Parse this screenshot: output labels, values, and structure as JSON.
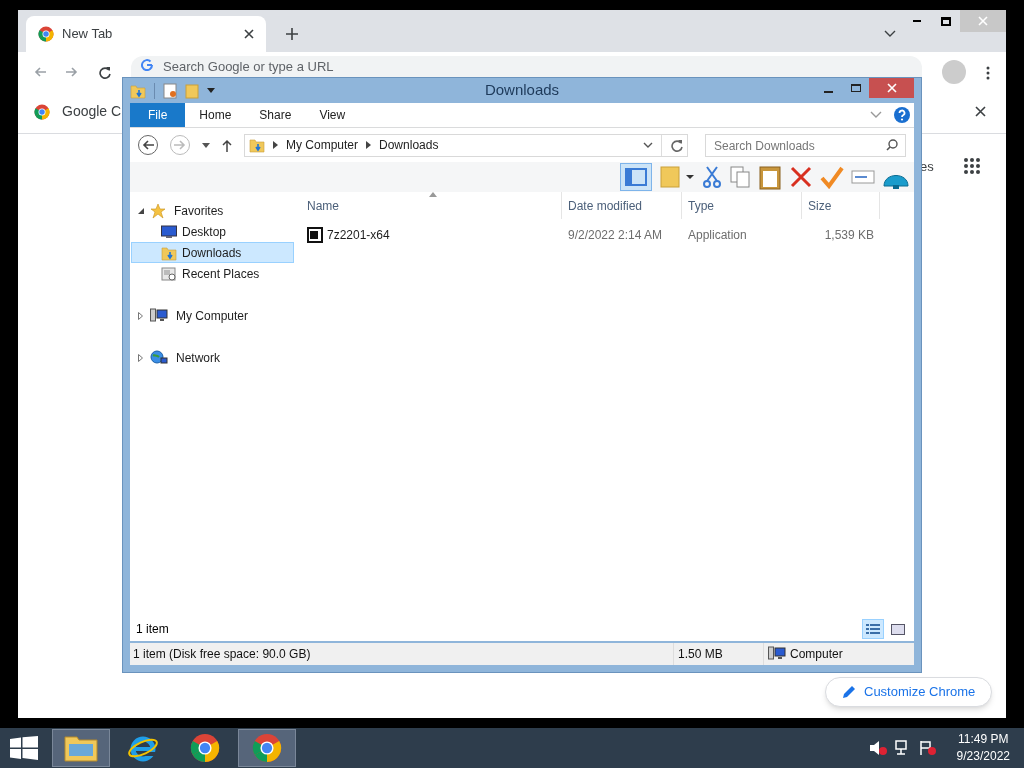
{
  "browser": {
    "tabs": [
      {
        "title": "New Tab",
        "selected": true
      }
    ],
    "omnibox": {
      "placeholder": "Search Google or type a URL"
    },
    "bookmarks": [
      {
        "label": "Google C"
      }
    ],
    "page": {
      "side_link": "es",
      "customize_button": "Customize Chrome"
    }
  },
  "explorer": {
    "title": "Downloads",
    "ribbon_tabs": [
      {
        "label": "File",
        "selected": true
      },
      {
        "label": "Home",
        "selected": false
      },
      {
        "label": "Share",
        "selected": false
      },
      {
        "label": "View",
        "selected": false
      }
    ],
    "breadcrumb": [
      "My Computer",
      "Downloads"
    ],
    "search": {
      "placeholder": "Search Downloads"
    },
    "nav": [
      {
        "label": "Favorites",
        "expanded": true,
        "children": [
          {
            "label": "Desktop",
            "selected": false
          },
          {
            "label": "Downloads",
            "selected": true
          },
          {
            "label": "Recent Places",
            "selected": false
          }
        ]
      },
      {
        "label": "My Computer",
        "expanded": false
      },
      {
        "label": "Network",
        "expanded": false
      }
    ],
    "columns": [
      "Name",
      "Date modified",
      "Type",
      "Size"
    ],
    "rows": [
      {
        "name": "7z2201-x64",
        "date": "9/2/2022 2:14 AM",
        "type": "Application",
        "size": "1,539 KB"
      }
    ],
    "item_count": "1 item",
    "status_bar": {
      "summary": "1 item (Disk free space: 90.0 GB)",
      "size": "1.50 MB",
      "location": "Computer"
    }
  },
  "taskbar": {
    "apps": [
      {
        "kind": "explorer",
        "active": true
      },
      {
        "kind": "ie",
        "active": false
      },
      {
        "kind": "chrome",
        "active": false
      },
      {
        "kind": "chrome",
        "active": true
      }
    ],
    "time": "11:49 PM",
    "date": "9/23/2022"
  }
}
